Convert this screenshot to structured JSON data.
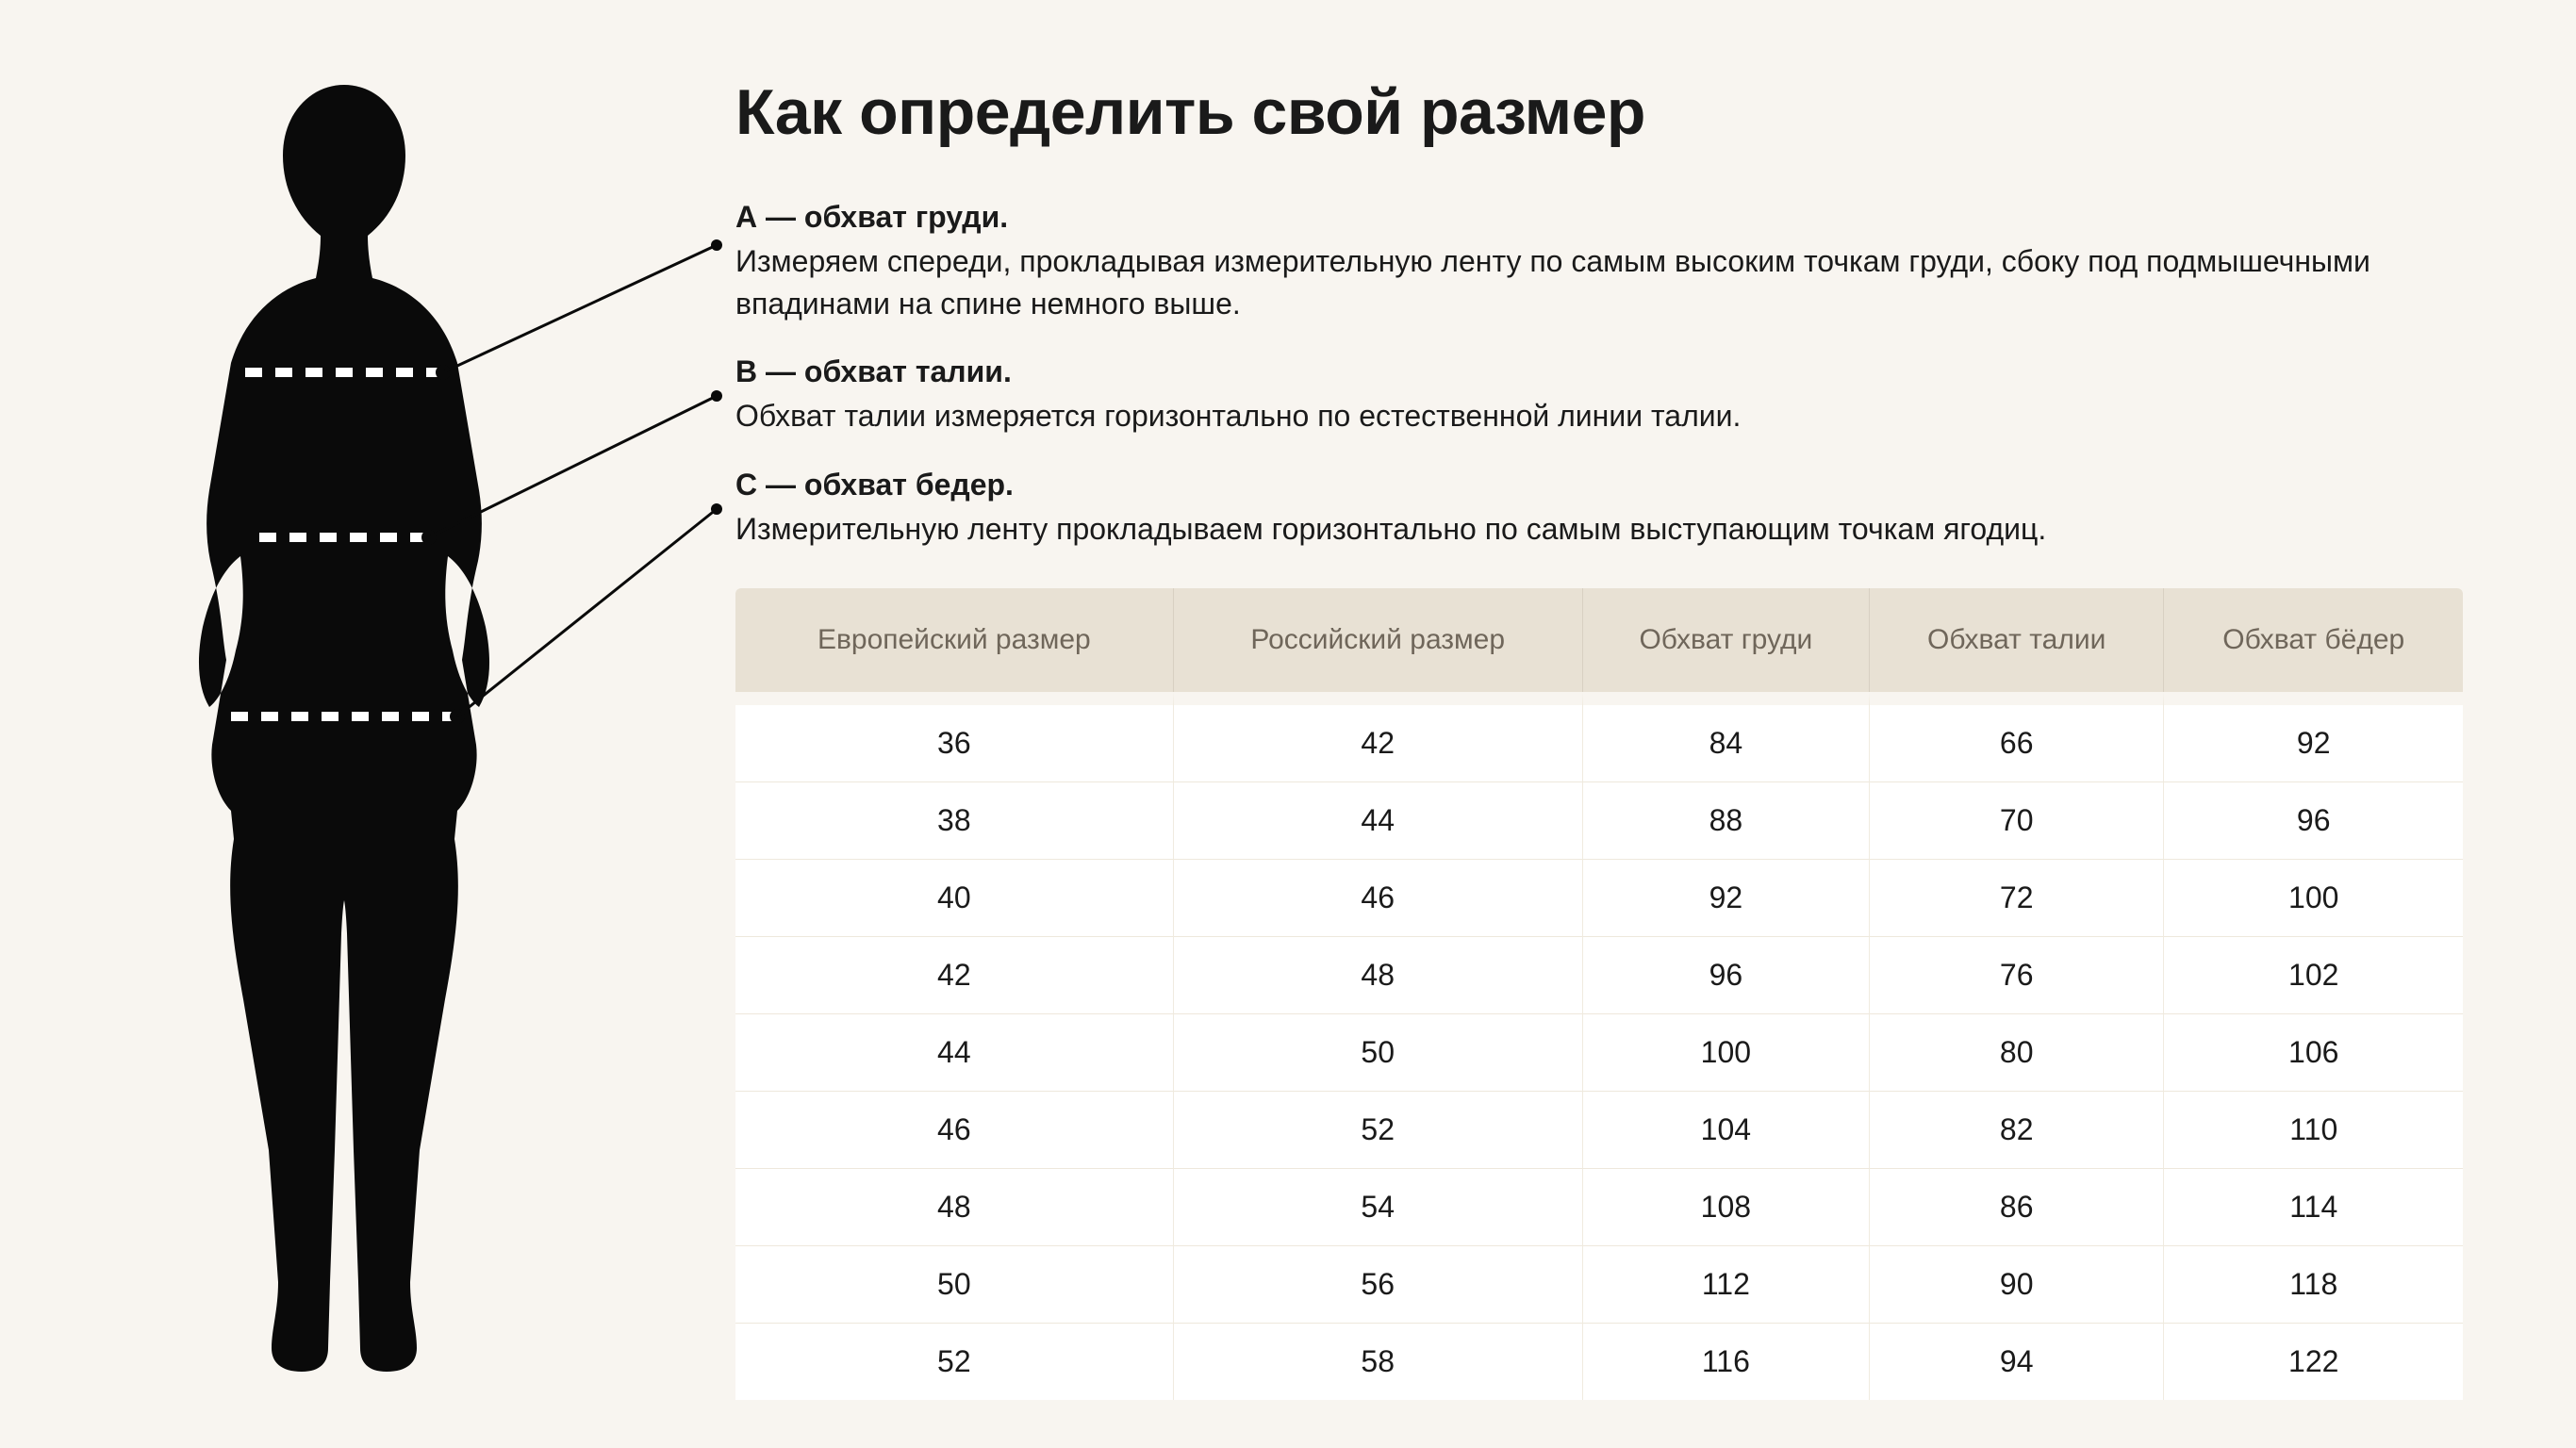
{
  "title": "Как определить свой размер",
  "measures": {
    "a": {
      "label": "А — обхват груди.",
      "desc": "Измеряем спереди, прокладывая измерительную ленту по самым высоким точкам груди, сбоку под подмышечными впадинами на спине немного выше."
    },
    "b": {
      "label": "В — обхват талии.",
      "desc": "Обхват талии измеряется горизонтально по естественной линии талии."
    },
    "c": {
      "label": "С — обхват бедер.",
      "desc": "Измерительную ленту прокладываем горизонтально по самым выступающим точкам ягодиц."
    }
  },
  "table": {
    "headers": [
      "Европейский размер",
      "Российский размер",
      "Обхват груди",
      "Обхват талии",
      "Обхват бёдер"
    ],
    "rows": [
      [
        36,
        42,
        84,
        66,
        92
      ],
      [
        38,
        44,
        88,
        70,
        96
      ],
      [
        40,
        46,
        92,
        72,
        100
      ],
      [
        42,
        48,
        96,
        76,
        102
      ],
      [
        44,
        50,
        100,
        80,
        106
      ],
      [
        46,
        52,
        104,
        82,
        110
      ],
      [
        48,
        54,
        108,
        86,
        114
      ],
      [
        50,
        56,
        112,
        90,
        118
      ],
      [
        52,
        58,
        116,
        94,
        122
      ]
    ]
  }
}
